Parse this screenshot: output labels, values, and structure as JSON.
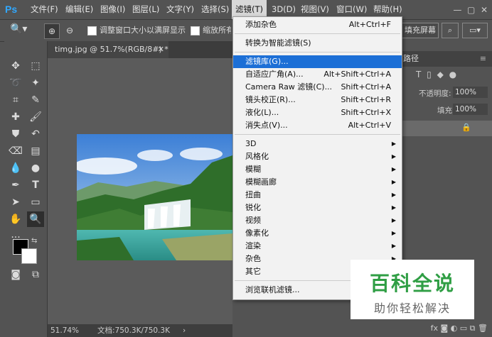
{
  "app": {
    "logo": "Ps"
  },
  "menubar": [
    "文件(F)",
    "编辑(E)",
    "图像(I)",
    "图层(L)",
    "文字(Y)",
    "选择(S)",
    "滤镜(T)",
    "3D(D)",
    "视图(V)",
    "窗口(W)",
    "帮助(H)"
  ],
  "options": {
    "resize_window": "调整窗口大小以满屏显示",
    "zoom_all": "缩放所有",
    "fill_screen": "填充屏幕"
  },
  "document": {
    "tab_title": "timg.jpg @ 51.7%(RGB/8#) *",
    "zoom": "51.74%",
    "doc_size": "文档:750.3K/750.3K"
  },
  "right_panel": {
    "tab_label": "路径",
    "opacity_label": "不透明度:",
    "opacity_value": "100%",
    "fill_label": "填充:",
    "fill_value": "100%"
  },
  "filter_menu": {
    "groups": [
      [
        {
          "label": "添加杂色",
          "shortcut": "Alt+Ctrl+F"
        }
      ],
      [
        {
          "label": "转换为智能滤镜(S)",
          "shortcut": ""
        }
      ],
      [
        {
          "label": "滤镜库(G)...",
          "shortcut": "",
          "highlight": true
        },
        {
          "label": "自适应广角(A)...",
          "shortcut": "Alt+Shift+Ctrl+A"
        },
        {
          "label": "Camera Raw 滤镜(C)...",
          "shortcut": "Shift+Ctrl+A"
        },
        {
          "label": "镜头校正(R)...",
          "shortcut": "Shift+Ctrl+R"
        },
        {
          "label": "液化(L)...",
          "shortcut": "Shift+Ctrl+X"
        },
        {
          "label": "消失点(V)...",
          "shortcut": "Alt+Ctrl+V"
        }
      ],
      [
        {
          "label": "3D",
          "submenu": true
        },
        {
          "label": "风格化",
          "submenu": true
        },
        {
          "label": "模糊",
          "submenu": true
        },
        {
          "label": "模糊画廊",
          "submenu": true
        },
        {
          "label": "扭曲",
          "submenu": true
        },
        {
          "label": "锐化",
          "submenu": true
        },
        {
          "label": "视频",
          "submenu": true
        },
        {
          "label": "像素化",
          "submenu": true
        },
        {
          "label": "渲染",
          "submenu": true
        },
        {
          "label": "杂色",
          "submenu": true
        },
        {
          "label": "其它",
          "submenu": true
        }
      ],
      [
        {
          "label": "浏览联机滤镜...",
          "shortcut": ""
        }
      ]
    ]
  },
  "watermark": {
    "title": "百科全说",
    "subtitle": "助你轻松解决"
  },
  "colors": {
    "ui_bg": "#535353",
    "menu_bg": "#f2f2f2",
    "highlight": "#1c6fd6",
    "watermark_green": "#2f9e44"
  }
}
